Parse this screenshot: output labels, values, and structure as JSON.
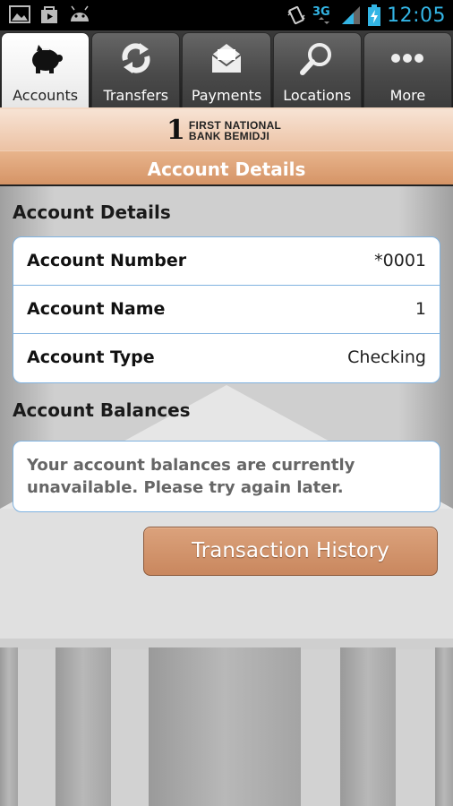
{
  "status_bar": {
    "time": "12:05",
    "network": "3G",
    "icons": [
      "image-icon",
      "play-store-icon",
      "android-icon",
      "vibrate-icon",
      "network-3g-icon",
      "signal-icon",
      "battery-charging-icon"
    ]
  },
  "tabs": [
    {
      "label": "Accounts",
      "icon": "piggy-bank-icon",
      "active": true
    },
    {
      "label": "Transfers",
      "icon": "transfer-arrows-icon",
      "active": false
    },
    {
      "label": "Payments",
      "icon": "envelope-icon",
      "active": false
    },
    {
      "label": "Locations",
      "icon": "magnifier-icon",
      "active": false
    },
    {
      "label": "More",
      "icon": "more-dots-icon",
      "active": false
    }
  ],
  "bank": {
    "logo_numeral": "1",
    "name_line1": "FIRST NATIONAL",
    "name_line2": "BANK BEMIDJI"
  },
  "title": "Account Details",
  "account_details": {
    "heading": "Account Details",
    "rows": [
      {
        "label": "Account Number",
        "value": "*0001"
      },
      {
        "label": "Account Name",
        "value": "1"
      },
      {
        "label": "Account Type",
        "value": "Checking"
      }
    ]
  },
  "account_balances": {
    "heading": "Account Balances",
    "message": "Your account balances are currently unavailable. Please try again later."
  },
  "button": {
    "label": "Transaction History"
  },
  "colors": {
    "accent": "#d59466",
    "card_border": "#7fb2e0",
    "time": "#33b5e5"
  }
}
